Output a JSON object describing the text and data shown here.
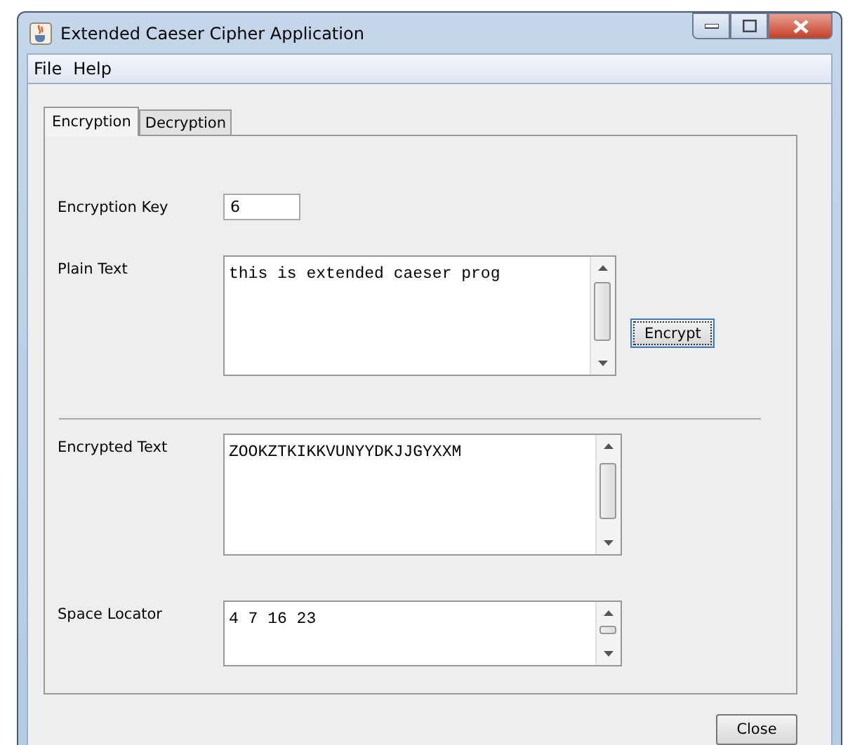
{
  "window": {
    "title": "Extended Caeser Cipher Application"
  },
  "menu": [
    "File",
    "Help"
  ],
  "tabs": [
    {
      "label": "Encryption",
      "selected": true
    },
    {
      "label": "Decryption",
      "selected": false
    }
  ],
  "encrypt_button": "Encrypt",
  "fields": [
    {
      "kind": "input",
      "label": "Encryption Key",
      "value": "6"
    },
    {
      "kind": "textarea",
      "label": "Plain Text",
      "value": "this is extended caeser prog"
    },
    {
      "kind": "textarea",
      "label": "Encrypted Text",
      "value": "ZOOKZTKIKKVUNYYDKJJGYXXM"
    },
    {
      "kind": "textarea",
      "label": "Space Locator",
      "value": "4 7 16 23"
    }
  ],
  "close_button": "Close"
}
